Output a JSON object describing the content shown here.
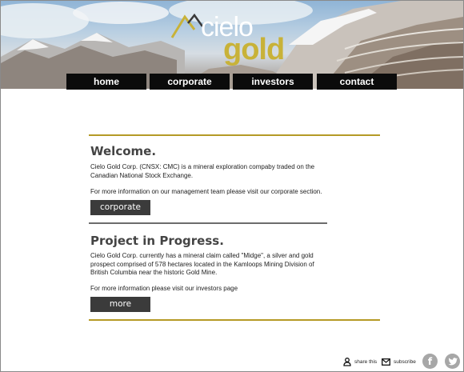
{
  "brand": {
    "word1": "cielo",
    "word2": "gold"
  },
  "nav": {
    "items": [
      {
        "label": "home"
      },
      {
        "label": "corporate"
      },
      {
        "label": "investors"
      },
      {
        "label": "contact"
      }
    ]
  },
  "welcome": {
    "heading": "Welcome.",
    "para1_line1": "Cielo Gold Corp. (CNSX: CMC) is a mineral exploration compaby traded on the",
    "para1_line2": "Canadian National Stock Exchange.",
    "para2": "For more information on our management team please visit our corporate section.",
    "button": "corporate"
  },
  "project": {
    "heading": "Project in Progress.",
    "line1": "Cielo Gold Corp. currently has a mineral claim called \"Midge\", a silver and gold",
    "line2": "prospect comprised of 578 hectares located in the Kamloops Mining Division of",
    "line3": "British Columbia near the historic Gold Mine.",
    "para2": "For more information please visit our investors page",
    "button": "more"
  },
  "footer": {
    "share": "share this",
    "subscribe": "subscribe"
  },
  "social": {
    "facebook": "f",
    "twitter": "t"
  },
  "colors": {
    "accent": "#b59a26",
    "nav_bg": "#0b0b0b",
    "button_bg": "#3b3b3b",
    "social_bg": "#a7a7a7"
  }
}
